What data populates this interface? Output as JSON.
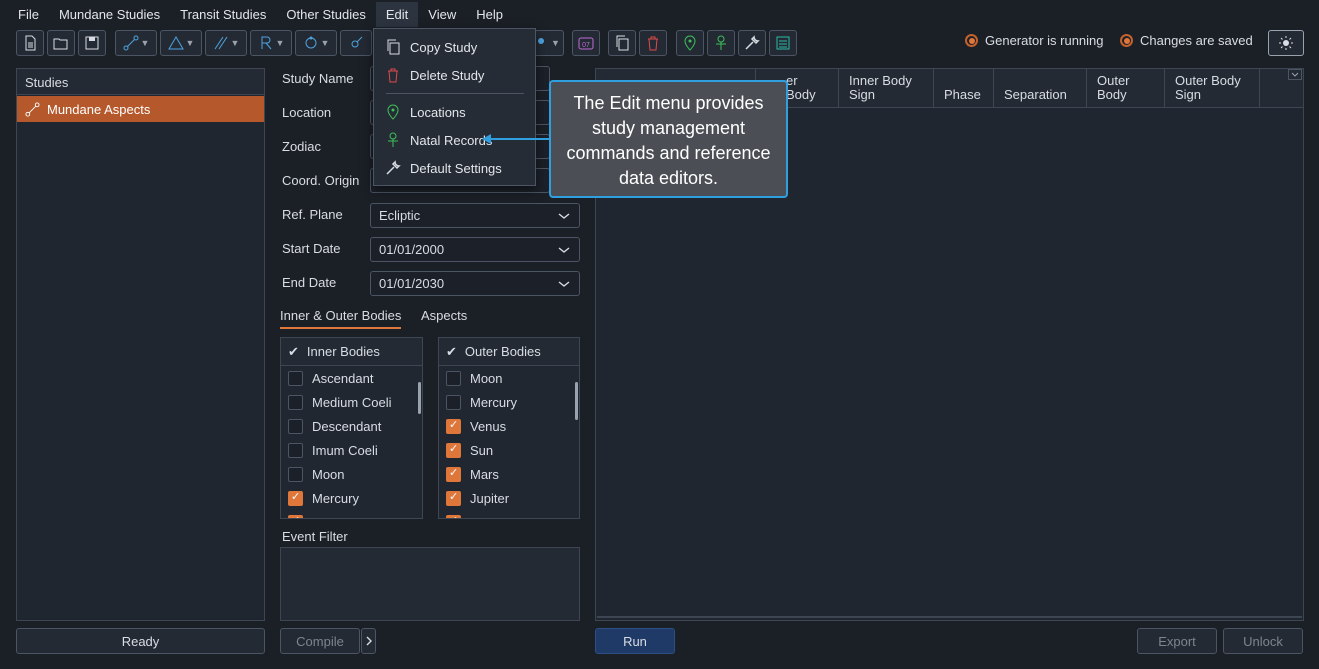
{
  "menubar": {
    "items": [
      "File",
      "Mundane Studies",
      "Transit Studies",
      "Other Studies",
      "Edit",
      "View",
      "Help"
    ]
  },
  "status": {
    "generator": "Generator is running",
    "saved": "Changes are saved"
  },
  "studies": {
    "header": "Studies",
    "items": [
      "Mundane Aspects"
    ],
    "status": "Ready"
  },
  "form": {
    "study_name_label": "Study Name",
    "location_label": "Location",
    "zodiac_label": "Zodiac",
    "coord_origin_label": "Coord. Origin",
    "ref_plane_label": "Ref. Plane",
    "ref_plane_value": "Ecliptic",
    "start_date_label": "Start Date",
    "start_date_value": "01/01/2000",
    "end_date_label": "End Date",
    "end_date_value": "01/01/2030"
  },
  "tabs": {
    "bodies": "Inner & Outer Bodies",
    "aspects": "Aspects"
  },
  "inner": {
    "header": "Inner Bodies",
    "items": [
      {
        "name": "Ascendant",
        "checked": false
      },
      {
        "name": "Medium Coeli",
        "checked": false
      },
      {
        "name": "Descendant",
        "checked": false
      },
      {
        "name": "Imum Coeli",
        "checked": false
      },
      {
        "name": "Moon",
        "checked": false
      },
      {
        "name": "Mercury",
        "checked": true
      }
    ]
  },
  "outer": {
    "header": "Outer Bodies",
    "items": [
      {
        "name": "Moon",
        "checked": false
      },
      {
        "name": "Mercury",
        "checked": false
      },
      {
        "name": "Venus",
        "checked": true
      },
      {
        "name": "Sun",
        "checked": true
      },
      {
        "name": "Mars",
        "checked": true
      },
      {
        "name": "Jupiter",
        "checked": true
      }
    ]
  },
  "event_filter": {
    "label": "Event Filter"
  },
  "buttons": {
    "compile": "Compile",
    "run": "Run",
    "export": "Export",
    "unlock": "Unlock"
  },
  "grid": {
    "columns": [
      "er Body",
      "Inner Body Sign",
      "Phase",
      "Separation",
      "Outer Body",
      "Outer Body Sign"
    ]
  },
  "edit_menu": {
    "items": [
      "Copy Study",
      "Delete Study",
      "Locations",
      "Natal Records",
      "Default Settings"
    ]
  },
  "callout": {
    "text": "The Edit menu provides study management commands and reference data editors."
  },
  "colors": {
    "accent": "#e0773a",
    "selection": "#b5582b",
    "callout_border": "#2f9fe0"
  }
}
